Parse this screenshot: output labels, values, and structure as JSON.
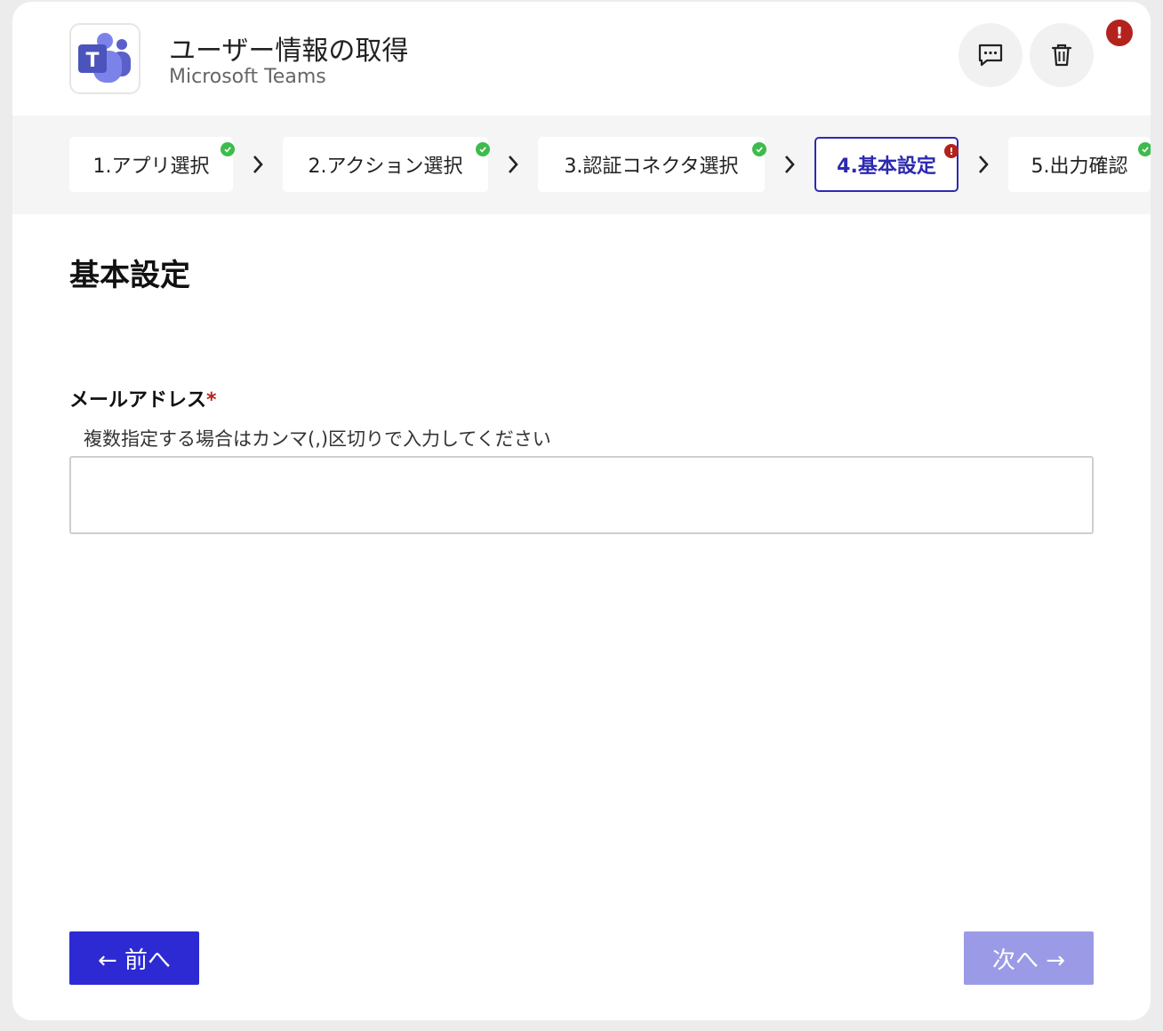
{
  "header": {
    "title": "ユーザー情報の取得",
    "subtitle": "Microsoft Teams",
    "app_icon": "microsoft-teams-icon",
    "actions": [
      {
        "name": "comment",
        "icon": "comment-icon"
      },
      {
        "name": "delete",
        "icon": "trash-icon"
      }
    ],
    "alert_badge": "!"
  },
  "steps": [
    {
      "label": "1.アプリ選択",
      "status": "complete"
    },
    {
      "label": "2.アクション選択",
      "status": "complete"
    },
    {
      "label": "3.認証コネクタ選択",
      "status": "complete"
    },
    {
      "label": "4.基本設定",
      "status": "error",
      "active": true,
      "badge": "!"
    },
    {
      "label": "5.出力確認",
      "status": "complete"
    }
  ],
  "section": {
    "title": "基本設定"
  },
  "email_field": {
    "label": "メールアドレス",
    "required_mark": "*",
    "hint": "複数指定する場合はカンマ(,)区切りで入力してください",
    "value": "",
    "placeholder": ""
  },
  "navigation": {
    "prev_label": "← 前へ",
    "next_label": "次へ →"
  },
  "colors": {
    "accent": "#2d2ad4",
    "accent_disabled": "#9b9ae6",
    "success": "#3dbb4c",
    "error": "#b3221c",
    "teams_purple": "#5b5fc7"
  }
}
